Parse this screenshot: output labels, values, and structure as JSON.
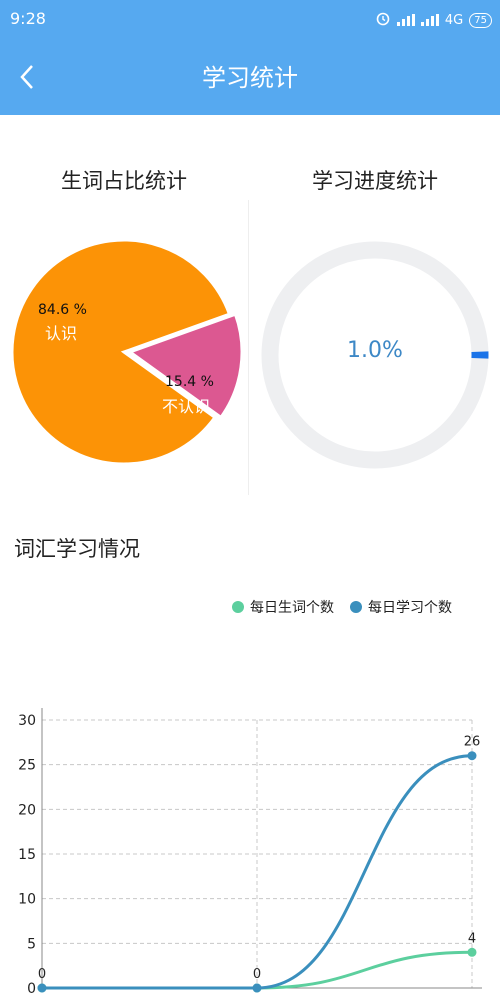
{
  "status": {
    "time": "9:28",
    "network": "4G",
    "battery": "75"
  },
  "header": {
    "title": "学习统计",
    "back_icon": "chevron-left-icon"
  },
  "word_ratio": {
    "title": "生词占比统计",
    "slices": [
      {
        "percent_label": "84.6 %",
        "label": "认识",
        "value": 84.6,
        "color": "#fc9306"
      },
      {
        "percent_label": "15.4 %",
        "label": "不认识",
        "value": 15.4,
        "color": "#dc5891"
      }
    ]
  },
  "progress": {
    "title": "学习进度统计",
    "value_label": "1.0%",
    "value": 1.0,
    "color": "#1a73e8",
    "track_color": "#eeeff1"
  },
  "vocab": {
    "title": "词汇学习情况"
  },
  "chart_data": {
    "type": "line",
    "x": [
      1,
      2,
      3
    ],
    "ylim": [
      0,
      30
    ],
    "yticks": [
      0,
      5,
      10,
      15,
      20,
      25,
      30
    ],
    "grid": true,
    "legend_position": "top-right",
    "series": [
      {
        "name": "每日生词个数",
        "values": [
          0,
          0,
          4
        ],
        "color": "#5ccf9e"
      },
      {
        "name": "每日学习个数",
        "values": [
          0,
          0,
          26
        ],
        "color": "#3a8fbd"
      }
    ],
    "data_labels": [
      {
        "text": "0",
        "point": 0
      },
      {
        "text": "0",
        "point": 1
      },
      {
        "text": "4",
        "point": 2,
        "series": 0
      },
      {
        "text": "26",
        "point": 2,
        "series": 1
      }
    ]
  }
}
